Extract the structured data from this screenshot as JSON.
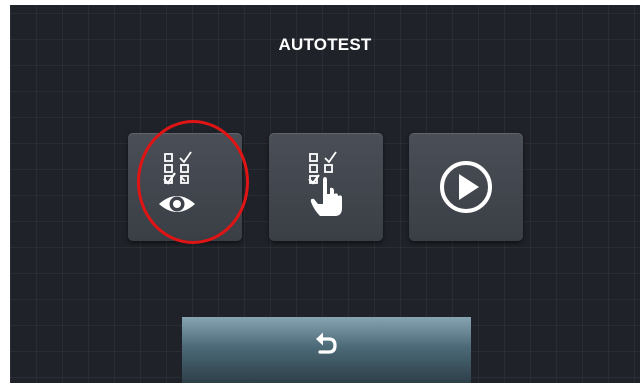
{
  "header": {
    "title": "AUTOTEST"
  },
  "tiles": [
    {
      "icon": "checklist-eye-icon"
    },
    {
      "icon": "checklist-hand-icon"
    },
    {
      "icon": "play-circle-icon"
    }
  ],
  "footer": {
    "back_icon": "return-arrow-icon"
  },
  "colors": {
    "background": "#1f2329",
    "tile": "#42464d",
    "highlight_ring": "#e01414",
    "back_button": "#5f7e8c",
    "icon": "#ffffff"
  }
}
